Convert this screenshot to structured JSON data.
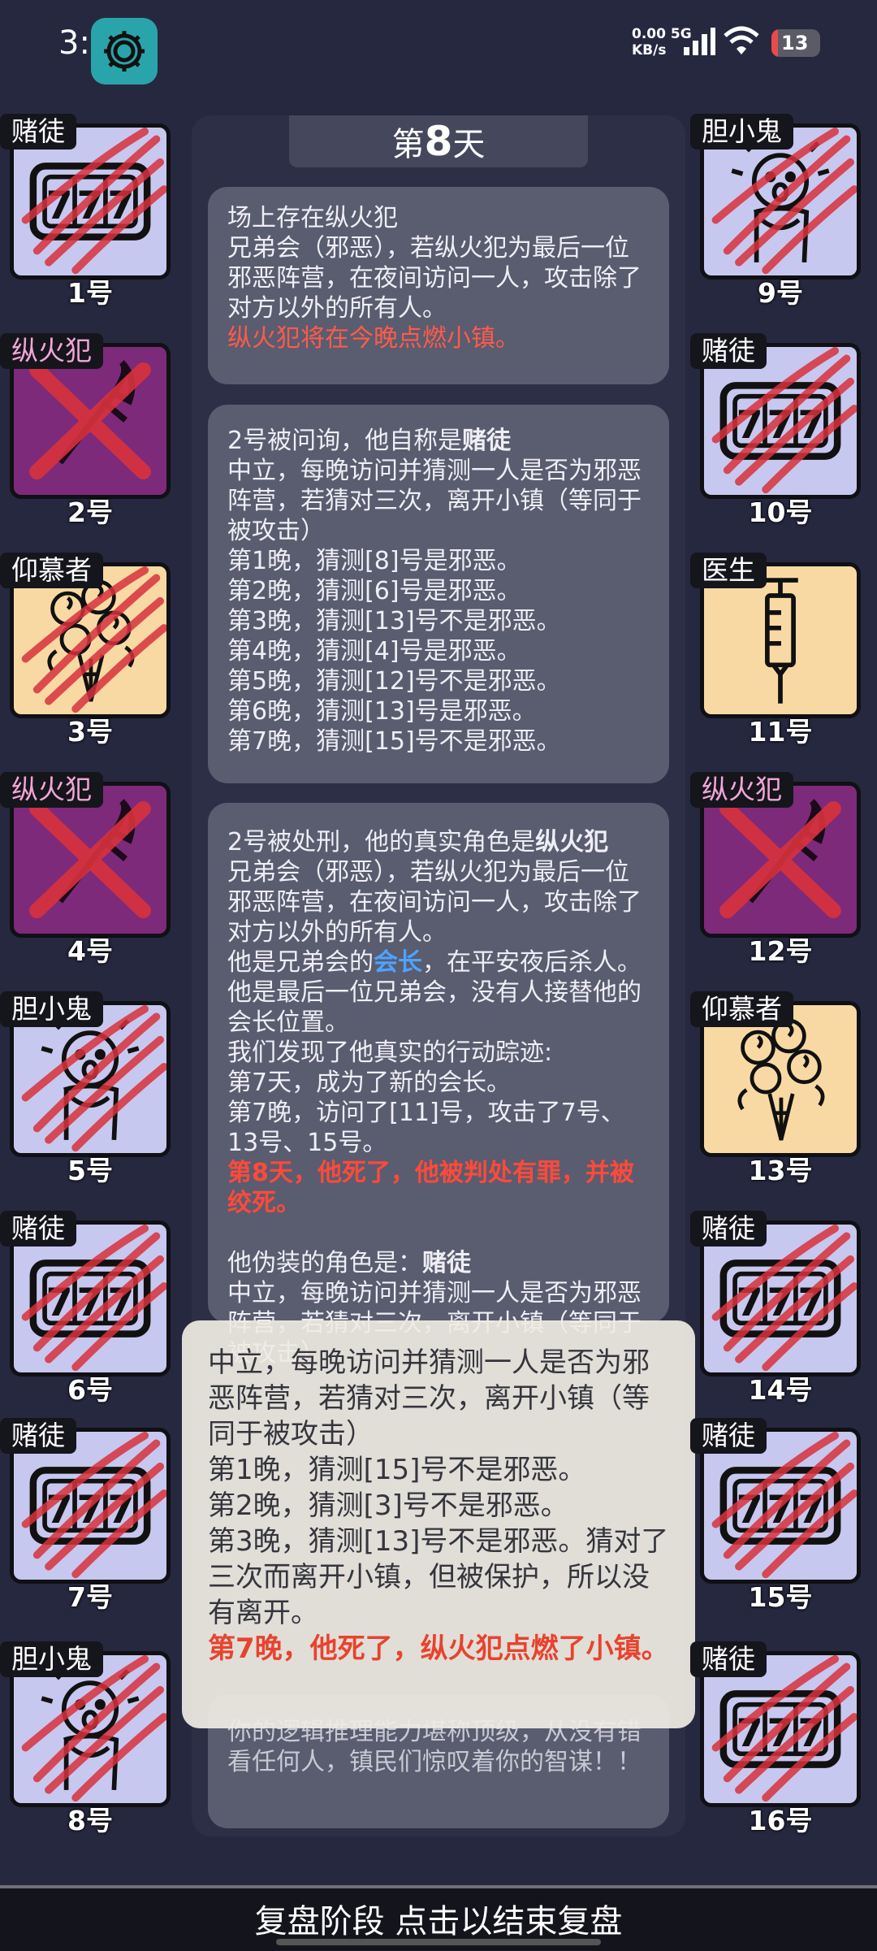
{
  "status_bar": {
    "time": "3:03",
    "net_speed_value": "0.00",
    "net_speed_unit": "KB/s",
    "network": "5G",
    "battery": "13",
    "battery_level": 0.13
  },
  "day_header": {
    "prefix": "第",
    "day": "8",
    "suffix": "天"
  },
  "players": [
    {
      "role": "赌徒",
      "number": "1号",
      "icon": "slot-machine-777-icon",
      "dead": true,
      "evil": false
    },
    {
      "role": "纵火犯",
      "number": "2号",
      "icon": "torch-icon",
      "dead": true,
      "evil": true
    },
    {
      "role": "仰慕者",
      "number": "3号",
      "icon": "rose-bouquet-icon",
      "dead": true,
      "evil": false
    },
    {
      "role": "纵火犯",
      "number": "4号",
      "icon": "torch-icon",
      "dead": true,
      "evil": true
    },
    {
      "role": "胆小鬼",
      "number": "5号",
      "icon": "scared-person-icon",
      "dead": true,
      "evil": false
    },
    {
      "role": "赌徒",
      "number": "6号",
      "icon": "slot-machine-777-icon",
      "dead": true,
      "evil": false
    },
    {
      "role": "赌徒",
      "number": "7号",
      "icon": "slot-machine-777-icon",
      "dead": true,
      "evil": false
    },
    {
      "role": "胆小鬼",
      "number": "8号",
      "icon": "scared-person-icon",
      "dead": true,
      "evil": false
    },
    {
      "role": "胆小鬼",
      "number": "9号",
      "icon": "scared-person-icon",
      "dead": true,
      "evil": false
    },
    {
      "role": "赌徒",
      "number": "10号",
      "icon": "slot-machine-777-icon",
      "dead": true,
      "evil": false
    },
    {
      "role": "医生",
      "number": "11号",
      "icon": "syringe-icon",
      "dead": false,
      "evil": false
    },
    {
      "role": "纵火犯",
      "number": "12号",
      "icon": "torch-icon",
      "dead": true,
      "evil": true
    },
    {
      "role": "仰慕者",
      "number": "13号",
      "icon": "rose-bouquet-icon",
      "dead": false,
      "evil": false
    },
    {
      "role": "赌徒",
      "number": "14号",
      "icon": "slot-machine-777-icon",
      "dead": true,
      "evil": false
    },
    {
      "role": "赌徒",
      "number": "15号",
      "icon": "slot-machine-777-icon",
      "dead": true,
      "evil": false
    },
    {
      "role": "赌徒",
      "number": "16号",
      "icon": "slot-machine-777-icon",
      "dead": true,
      "evil": false
    }
  ],
  "messages": {
    "m1": {
      "line1": "场上存在纵火犯",
      "line2": "兄弟会（邪恶），若纵火犯为最后一位邪恶阵营，在夜间访问一人，攻击除了对方以外的所有人。",
      "line3": "纵火犯将在今晚点燃小镇。"
    },
    "m2": {
      "line1_prefix": "2号被问询，他自称是",
      "line1_role": "赌徒",
      "desc": "中立，每晚访问并猜测一人是否为邪恶阵营，若猜对三次，离开小镇（等同于被攻击）",
      "nights": [
        "第1晚，猜测[8]号是邪恶。",
        "第2晚，猜测[6]号是邪恶。",
        "第3晚，猜测[13]号不是邪恶。",
        "第4晚，猜测[4]号是邪恶。",
        "第5晚，猜测[12]号不是邪恶。",
        "第6晚，猜测[13]号是邪恶。",
        "第7晚，猜测[15]号不是邪恶。"
      ]
    },
    "m3": {
      "line1_prefix": "2号被处刑，他的真实角色是",
      "line1_role": "纵火犯",
      "desc": "兄弟会（邪恶），若纵火犯为最后一位邪恶阵营，在夜间访问一人，攻击除了对方以外的所有人。",
      "leader_prefix": "他是兄弟会的",
      "leader_word": "会长",
      "leader_suffix": "，在平安夜后杀人。他是最后一位兄弟会，没有人接替他的会长位置。",
      "trace_intro": "我们发现了他真实的行动踪迹:",
      "trace1": "第7天，成为了新的会长。",
      "trace2": "第7晚，访问了[11]号，攻击了7号、13号、15号。",
      "verdict": "第8天，他死了，他被判处有罪，并被绞死。",
      "disguise_prefix": "他伪装的角色是：",
      "disguise_role": "赌徒",
      "disguise_desc": "中立，每晚访问并猜测一人是否为邪恶阵营，若猜对三次，离开小镇（等同于被攻击）"
    },
    "m4": {
      "text": "你的逻辑推理能力堪称顶级，从没有错看任何人，镇民们惊叹着你的智谋！！"
    }
  },
  "tooltip": {
    "desc": "中立，每晚访问并猜测一人是否为邪恶阵营，若猜对三次，离开小镇（等同于被攻击）",
    "night1": "第1晚，猜测[15]号不是邪恶。",
    "night2": "第2晚，猜测[3]号不是邪恶。",
    "night3": "第3晚，猜测[13]号不是邪恶。猜对了三次而离开小镇，但被保护，所以没有离开。",
    "death": "第7晚，他死了，纵火犯点燃了小镇。"
  },
  "bottom_bar": {
    "label": "复盘阶段 点击以结束复盘"
  },
  "colors": {
    "background": "#262840",
    "dead_mark": "#d8323c",
    "evil_role": "#f2a6d8",
    "highlight_red": "#ff4a3a",
    "leader_blue": "#4ea3ff"
  }
}
